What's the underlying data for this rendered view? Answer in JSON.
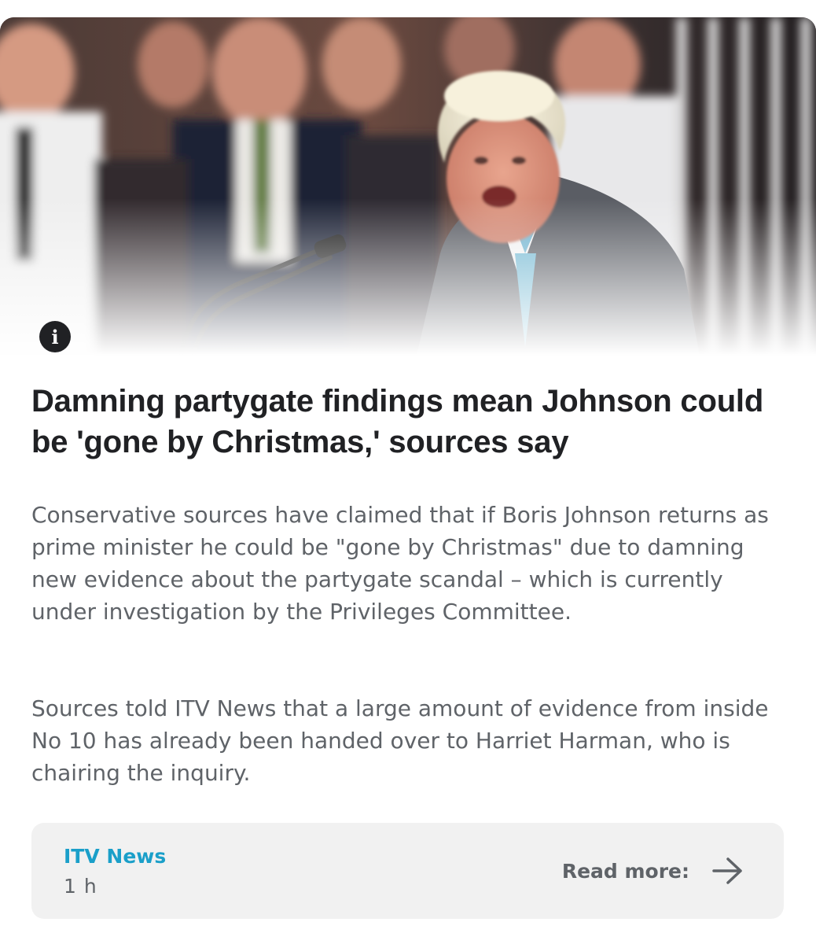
{
  "article": {
    "image_alt": "Boris Johnson speaking at a lectern in front of a crowd",
    "headline": "Damning partygate findings mean Johnson could be 'gone by Christmas,' sources say",
    "paragraphs": [
      "Conservative sources have claimed that if Boris Johnson returns as prime minister he could be \"gone by Christmas\" due to damning new evidence about the partygate scandal – which is currently under investigation by the Privileges Committee.",
      "Sources told ITV News that a large amount of evidence from inside No 10 has already been handed over to Harriet Harman, who is chairing the inquiry."
    ]
  },
  "info_badge": {
    "icon": "info-icon",
    "glyph": "i"
  },
  "source": {
    "name": "ITV News",
    "time": "1 h",
    "read_more_label": "Read more:",
    "arrow_icon": "arrow-right-icon"
  },
  "colors": {
    "headline": "#202124",
    "body": "#5f6368",
    "source_name": "#1a9fc9",
    "source_box_bg": "#f1f1f1"
  }
}
